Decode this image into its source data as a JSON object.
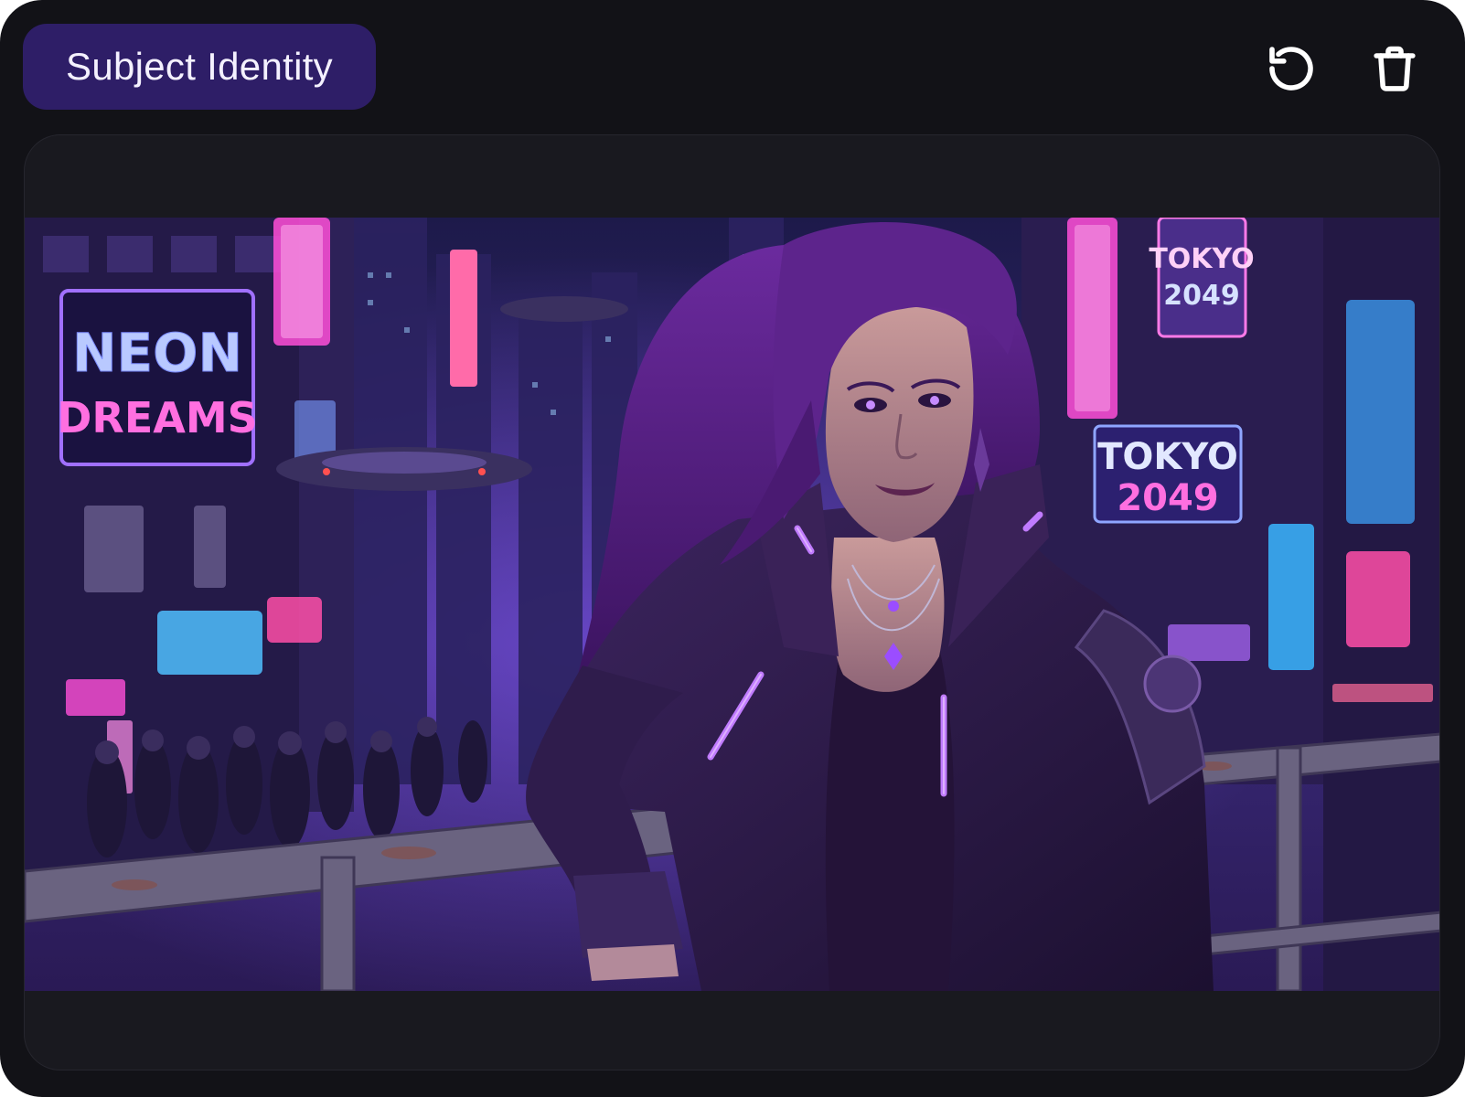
{
  "header": {
    "title": "Subject Identity",
    "actions": [
      {
        "name": "reset",
        "icon": "rotate-ccw-icon"
      },
      {
        "name": "delete",
        "icon": "trash-icon"
      }
    ]
  },
  "image": {
    "signs": {
      "neon_line1": "NEON",
      "neon_line2": "DREAMS",
      "tokyo_upper_line1": "TOKYO",
      "tokyo_upper_line2": "2049",
      "tokyo_lower_line1": "TOKYO",
      "tokyo_lower_line2": "2049"
    }
  },
  "colors": {
    "card_bg": "#121217",
    "pill_bg": "#2e1e67",
    "accent_purple": "#a855f7",
    "neon_pink": "#ff4fd8",
    "neon_blue": "#7fb4ff"
  }
}
